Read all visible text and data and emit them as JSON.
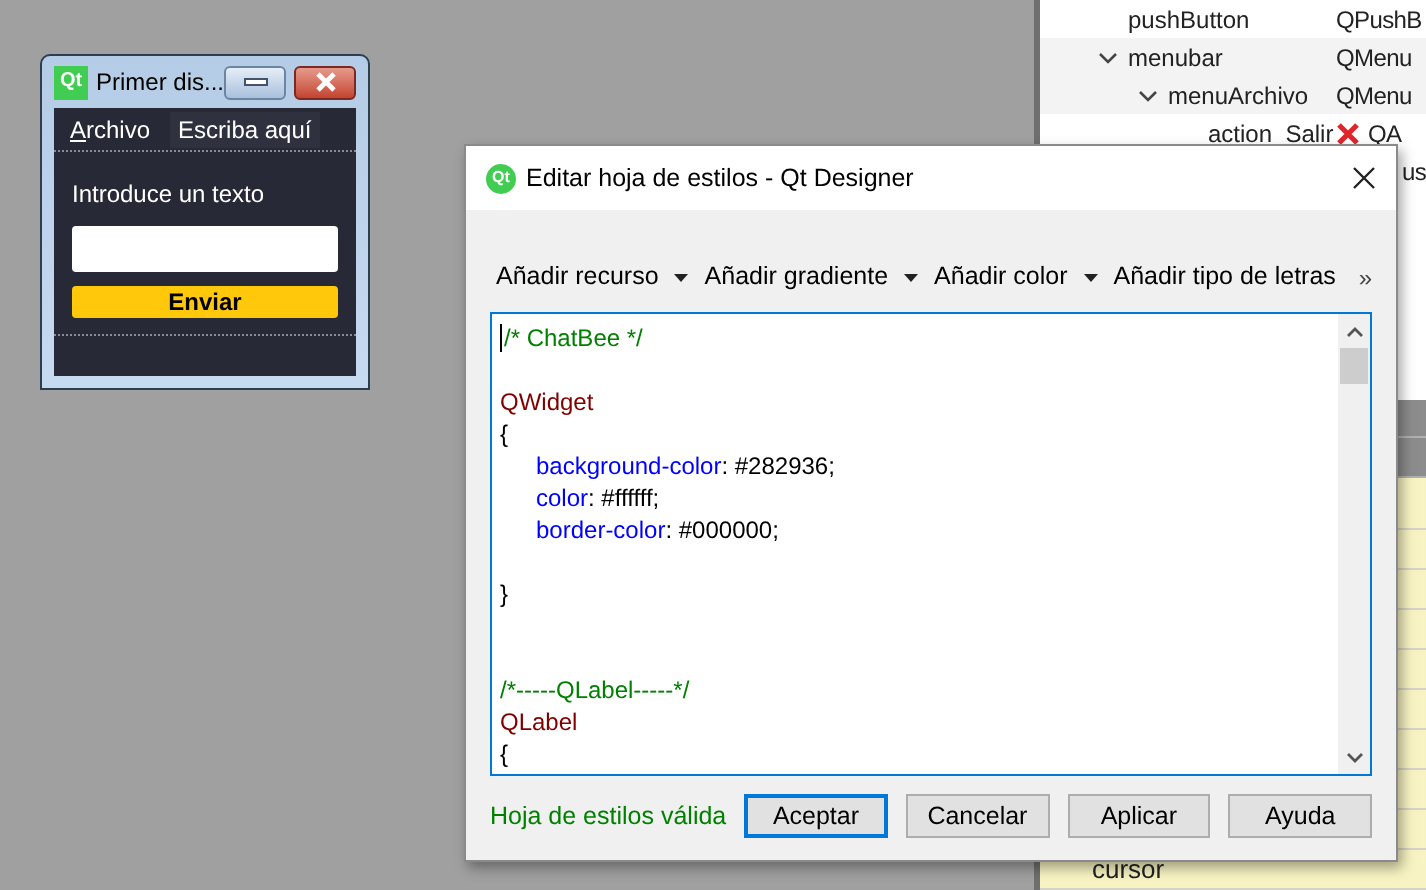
{
  "object_inspector": {
    "rows": [
      {
        "name": "pushButton",
        "class": "QPushB"
      },
      {
        "name": "menubar",
        "class": "QMenu",
        "expanded": true,
        "children": [
          {
            "name": "menuArchivo",
            "class": "QMenu",
            "expanded": true,
            "children": [
              {
                "name": "action_Salir",
                "class": "QA",
                "kind": "error"
              }
            ]
          }
        ]
      },
      {
        "class": "us"
      }
    ]
  },
  "property_editor": {
    "rows": [
      {
        "name": "cursor"
      }
    ]
  },
  "form_window": {
    "logo": "Qt",
    "title": "Primer dis...",
    "menus": [
      {
        "label": "Archivo",
        "kind": "menu"
      },
      {
        "label": "Escriba aquí",
        "kind": "placeholder"
      }
    ],
    "label": "Introduce un texto",
    "button": "Enviar"
  },
  "dialog": {
    "logo": "Qt",
    "title": "Editar hoja de estilos - Qt Designer",
    "toolbar": [
      {
        "label": "Añadir recurso",
        "dropdown": true
      },
      {
        "label": "Añadir gradiente",
        "dropdown": true
      },
      {
        "label": "Añadir color",
        "dropdown": true
      },
      {
        "label": "Añadir tipo de letras",
        "dropdown": false
      }
    ],
    "overflow": "»",
    "code": [
      {
        "kind": "comment",
        "text": "/* ChatBee */"
      },
      {
        "kind": "blank"
      },
      {
        "kind": "selector",
        "text": "QWidget"
      },
      {
        "kind": "brace",
        "text": "{"
      },
      {
        "kind": "property",
        "property": "background-color",
        "value": ": #282936;"
      },
      {
        "kind": "property",
        "property": "color",
        "value": ": #ffffff;"
      },
      {
        "kind": "property",
        "property": "border-color",
        "value": ": #000000;"
      },
      {
        "kind": "blank"
      },
      {
        "kind": "brace",
        "text": "}"
      },
      {
        "kind": "blank"
      },
      {
        "kind": "blank"
      },
      {
        "kind": "comment",
        "text": "/*-----QLabel-----*/"
      },
      {
        "kind": "selector",
        "text": "QLabel"
      },
      {
        "kind": "brace",
        "text": "{"
      }
    ],
    "status": "Hoja de estilos válida",
    "buttons": [
      {
        "label": "Aceptar",
        "default": true
      },
      {
        "label": "Cancelar",
        "default": false
      },
      {
        "label": "Aplicar",
        "default": false
      },
      {
        "label": "Ayuda",
        "default": false
      }
    ]
  }
}
